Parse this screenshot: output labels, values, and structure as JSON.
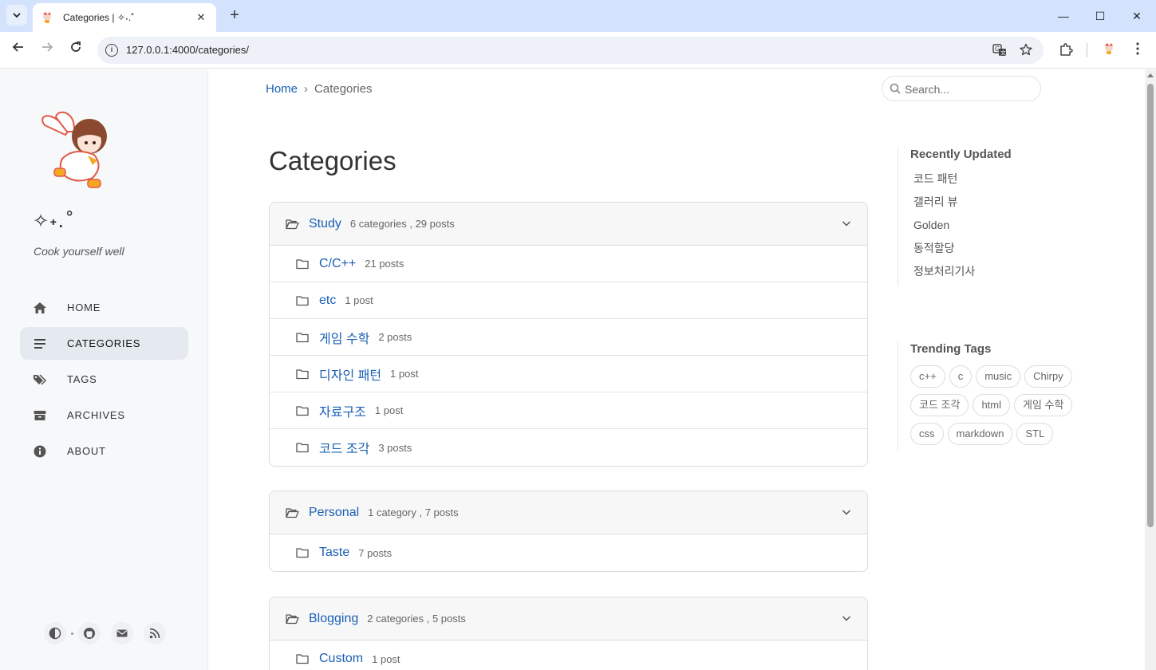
{
  "browser": {
    "tab_title": "Categories | ✧˖.˚",
    "tab_close": "✕",
    "new_tab": "+",
    "url": "127.0.0.1:4000/categories/",
    "window_controls": {
      "minimize": "—",
      "maximize": "☐",
      "close": "✕"
    }
  },
  "sidebar": {
    "site_title": "✧˖.˚",
    "subtitle": "Cook yourself well",
    "nav": [
      {
        "label": "HOME",
        "icon": "home-icon"
      },
      {
        "label": "CATEGORIES",
        "icon": "bars-icon",
        "active": true
      },
      {
        "label": "TAGS",
        "icon": "tags-icon"
      },
      {
        "label": "ARCHIVES",
        "icon": "archive-icon"
      },
      {
        "label": "ABOUT",
        "icon": "info-icon"
      }
    ]
  },
  "header": {
    "breadcrumb": {
      "home": "Home",
      "separator": "›",
      "current": "Categories"
    },
    "search_placeholder": "Search..."
  },
  "main": {
    "title": "Categories",
    "groups": [
      {
        "name": "Study",
        "summary": "6 categories , 29 posts",
        "items": [
          {
            "name": "C/C++",
            "count": "21 posts"
          },
          {
            "name": "etc",
            "count": "1 post"
          },
          {
            "name": "게임 수학",
            "count": "2 posts"
          },
          {
            "name": "디자인 패턴",
            "count": "1 post"
          },
          {
            "name": "자료구조",
            "count": "1 post"
          },
          {
            "name": "코드 조각",
            "count": "3 posts"
          }
        ]
      },
      {
        "name": "Personal",
        "summary": "1 category , 7 posts",
        "items": [
          {
            "name": "Taste",
            "count": "7 posts"
          }
        ]
      },
      {
        "name": "Blogging",
        "summary": "2 categories , 5 posts",
        "items": [
          {
            "name": "Custom",
            "count": "1 post"
          }
        ]
      }
    ]
  },
  "panel": {
    "recently_updated_title": "Recently Updated",
    "recently_updated": [
      "코드 패턴",
      "갤러리 뷰",
      "Golden",
      "동적할당",
      "정보처리기사"
    ],
    "trending_title": "Trending Tags",
    "tags": [
      "c++",
      "c",
      "music",
      "Chirpy",
      "코드 조각",
      "html",
      "게임 수학",
      "css",
      "markdown",
      "STL"
    ]
  },
  "colors": {
    "accent": "#1a5fb4",
    "chrome": "#d3e3fd",
    "sidebar_bg": "#f6f8fa"
  }
}
